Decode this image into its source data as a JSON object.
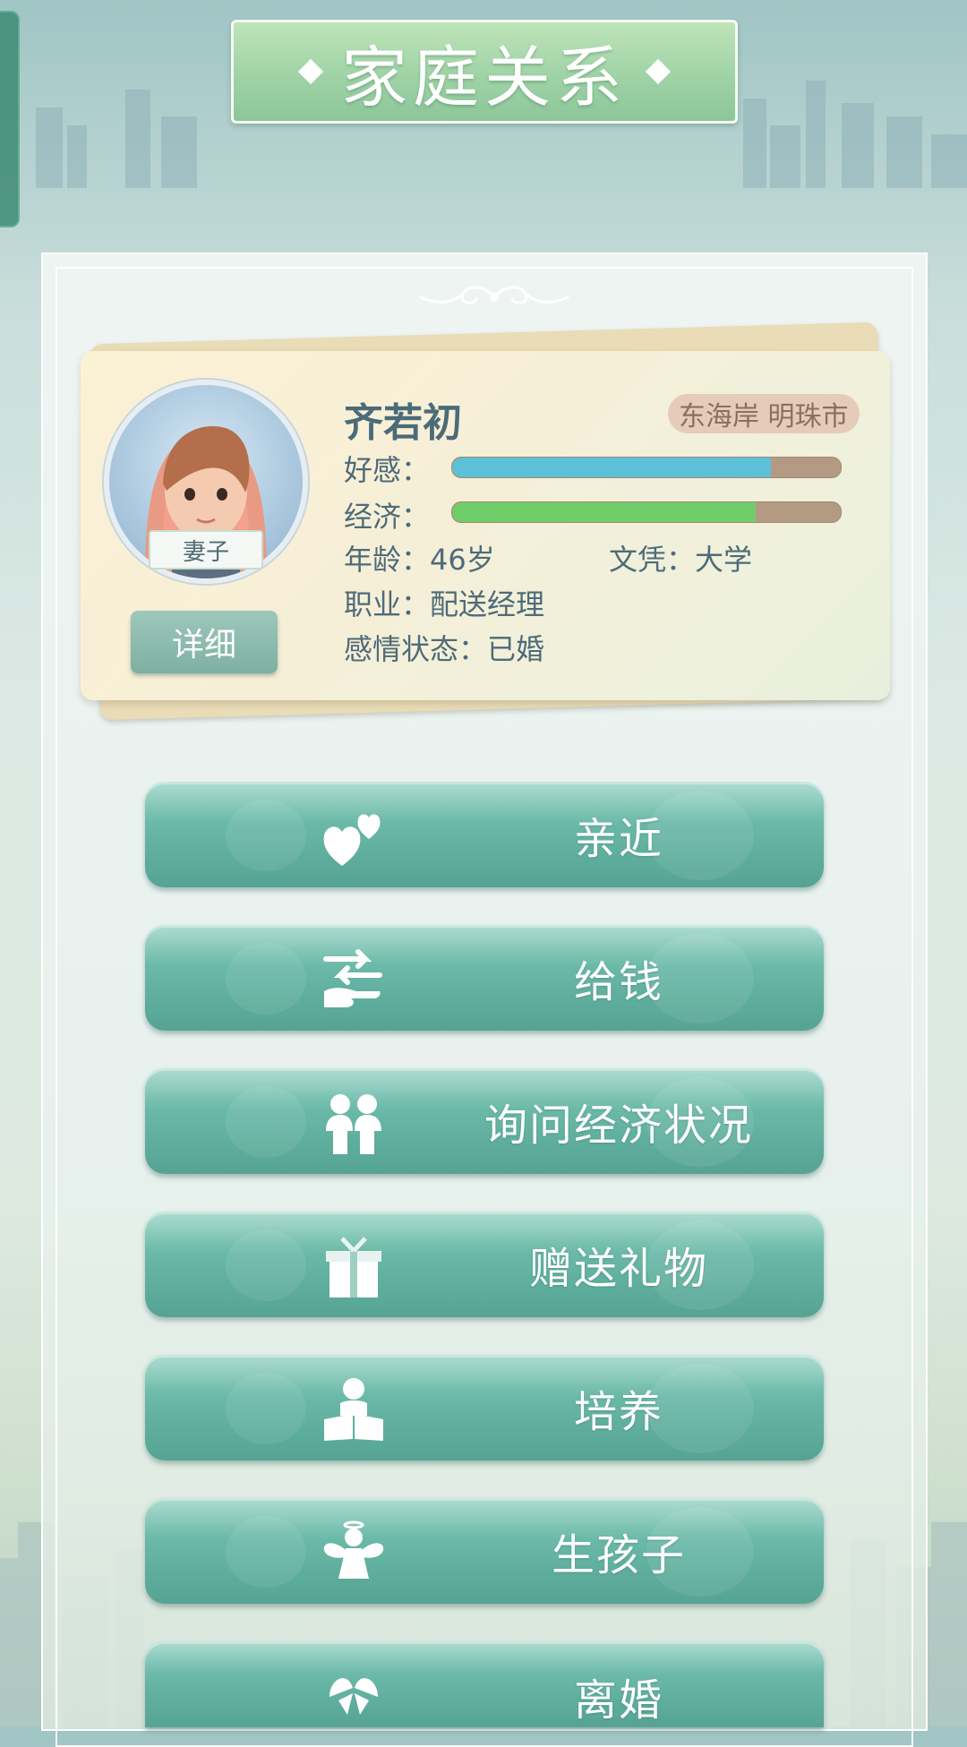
{
  "title": "家庭关系",
  "character": {
    "name": "齐若初",
    "location": "东海岸 明珠市",
    "role": "妻子",
    "detail_label": "详细",
    "stats": {
      "affection_label": "好感：",
      "affection_value": 0.82,
      "economy_label": "经济：",
      "economy_value": 0.78
    },
    "age_line": "年龄：46岁",
    "education_line": "文凭：大学",
    "job_line": "职业：配送经理",
    "relationship_line": "感情状态：已婚"
  },
  "actions": [
    {
      "label": "亲近",
      "icon": "hearts-icon"
    },
    {
      "label": "给钱",
      "icon": "hand-transfer-icon"
    },
    {
      "label": "询问经济状况",
      "icon": "two-people-icon"
    },
    {
      "label": "赠送礼物",
      "icon": "gift-icon"
    },
    {
      "label": "培养",
      "icon": "reading-child-icon"
    },
    {
      "label": "生孩子",
      "icon": "angel-icon"
    },
    {
      "label": "离婚",
      "icon": "broken-icon"
    }
  ],
  "colors": {
    "affection_bar": "#5cc1d8",
    "economy_bar": "#6fce6a",
    "button": "#66b5a4",
    "title_banner": "#a6d7a9"
  }
}
